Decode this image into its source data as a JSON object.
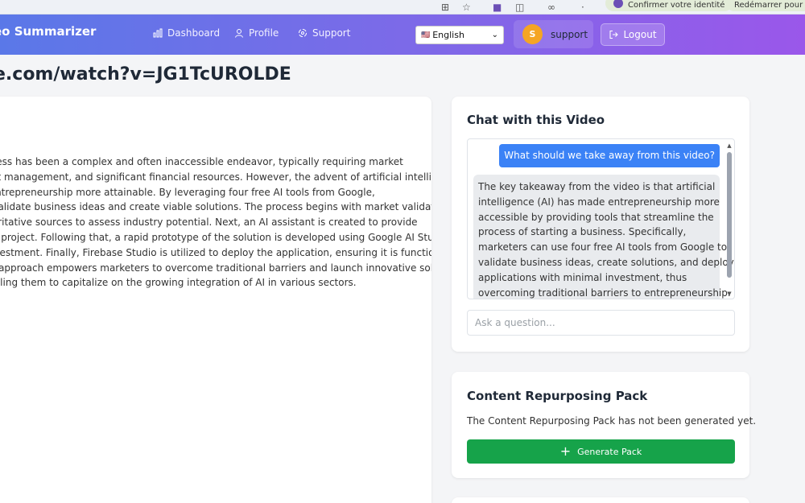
{
  "browser": {
    "pill1": "Confirmer votre identité",
    "pill2": "Redémarrer pour m"
  },
  "header": {
    "brand": "eo Summarizer",
    "nav": [
      {
        "label": "Dashboard",
        "icon": "bar-chart-icon"
      },
      {
        "label": "Profile",
        "icon": "user-icon"
      },
      {
        "label": "Support",
        "icon": "support-icon"
      }
    ],
    "language": {
      "flag": "🇺🇸",
      "selected": "English"
    },
    "user": {
      "initial": "S",
      "name": "support"
    },
    "logout_label": "Logout"
  },
  "page": {
    "title": "e.com/watch?v=JG1TcUROLDE"
  },
  "summary": {
    "lines": [
      "Starting a business has been a complex and often inaccessible endeavor, typically requiring market",
      "research, project management, and significant financial resources. However, the advent of artificial intelligence",
      "(AI) is making entrepreneurship more attainable. By leveraging four free AI tools from Google,",
      "marketers can validate business ideas and create viable solutions. The process begins with market validation using",
      "data from authoritative sources to assess industry potential. Next, an AI assistant is created to provide",
      "guidance on the project. Following that, a rapid prototype of the solution is developed using Google AI Studio,",
      "with minimal investment. Finally, Firebase Studio is utilized to deploy the application, ensuring it is functional and",
      "accessible. This approach empowers marketers to overcome traditional barriers and launch innovative solutions",
      "effectively, enabling them to capitalize on the growing integration of AI in various sectors."
    ]
  },
  "chat": {
    "title": "Chat with this Video",
    "user_message": "What should we take away from this video?",
    "bot_lines": [
      "The key takeaway from the video is that artificial",
      "intelligence (AI) has made entrepreneurship more",
      "accessible by providing tools that streamline the",
      "process of starting a business. Specifically,",
      "marketers can use four free AI tools from Google to",
      "validate business ideas, create solutions, and deploy",
      "applications with minimal investment, thus",
      "overcoming traditional barriers to entrepreneurship."
    ],
    "input_placeholder": "Ask a question..."
  },
  "repurpose": {
    "title": "Content Repurposing Pack",
    "status": "The Content Repurposing Pack has not been generated yet.",
    "button_label": "Generate Pack"
  },
  "colors": {
    "header_start": "#5a78e8",
    "header_end": "#9a57ea",
    "user_bubble": "#3b82f6",
    "generate_button": "#16a34a",
    "avatar": "#f5a524"
  }
}
